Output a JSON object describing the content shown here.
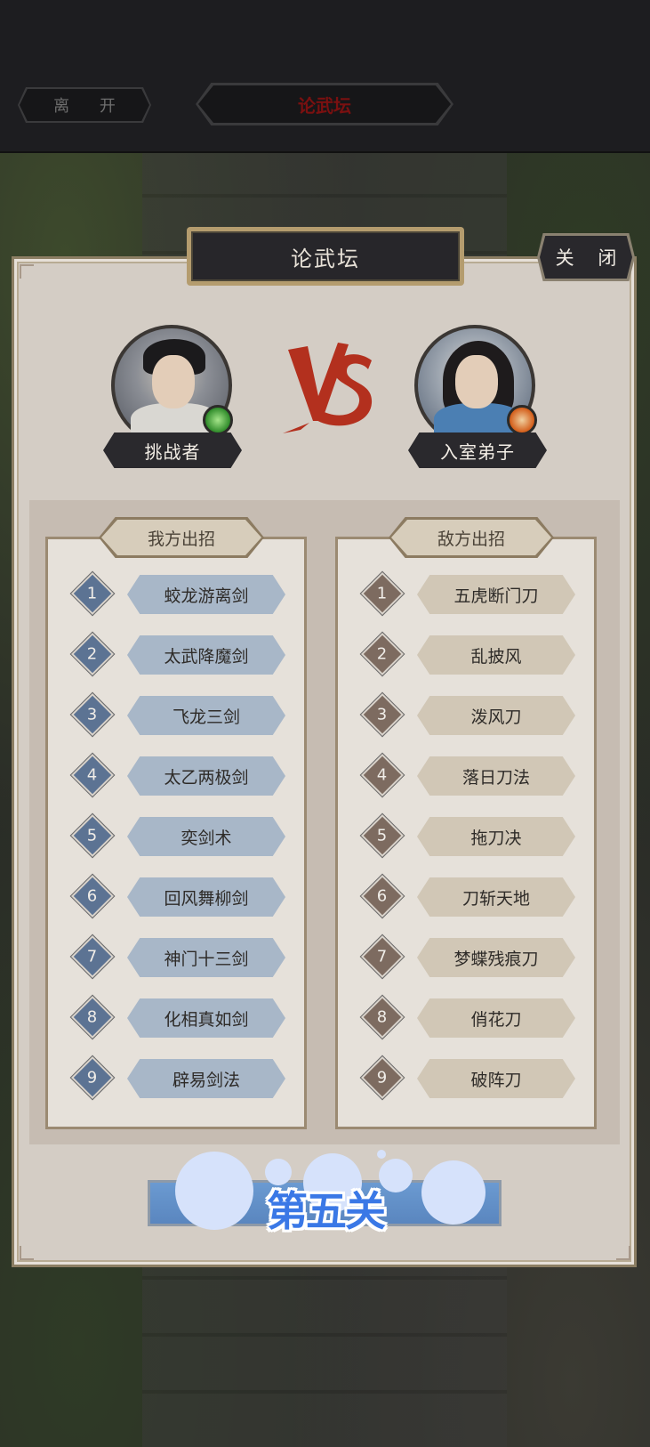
{
  "header": {
    "leave_label": "离 开",
    "title": "论武坛"
  },
  "panel": {
    "title": "论武坛",
    "close_label": "关 闭"
  },
  "challenger": {
    "label": "挑战者",
    "element_badge_color": "#2f8b2a"
  },
  "opponent": {
    "label": "入室弟子",
    "element_badge_color": "#d35c18"
  },
  "vs_text": "VS",
  "my_moves": {
    "header": "我方出招",
    "items": [
      {
        "num": "1",
        "name": "蛟龙游离剑"
      },
      {
        "num": "2",
        "name": "太武降魔剑"
      },
      {
        "num": "3",
        "name": "飞龙三剑"
      },
      {
        "num": "4",
        "name": "太乙两极剑"
      },
      {
        "num": "5",
        "name": "奕剑术"
      },
      {
        "num": "6",
        "name": "回风舞柳剑"
      },
      {
        "num": "7",
        "name": "神门十三剑"
      },
      {
        "num": "8",
        "name": "化相真如剑"
      },
      {
        "num": "9",
        "name": "辟易剑法"
      }
    ]
  },
  "enemy_moves": {
    "header": "敌方出招",
    "items": [
      {
        "num": "1",
        "name": "五虎断门刀"
      },
      {
        "num": "2",
        "name": "乱披风"
      },
      {
        "num": "3",
        "name": "泼风刀"
      },
      {
        "num": "4",
        "name": "落日刀法"
      },
      {
        "num": "5",
        "name": "拖刀决"
      },
      {
        "num": "6",
        "name": "刀斩天地"
      },
      {
        "num": "7",
        "name": "梦蝶残痕刀"
      },
      {
        "num": "8",
        "name": "俏花刀"
      },
      {
        "num": "9",
        "name": "破阵刀"
      }
    ]
  },
  "stage_label": "第五关",
  "colors": {
    "my_move_bg": "#a8b7c8",
    "enemy_move_bg": "#d1c7b6",
    "stage_text": "#3a78e6"
  }
}
